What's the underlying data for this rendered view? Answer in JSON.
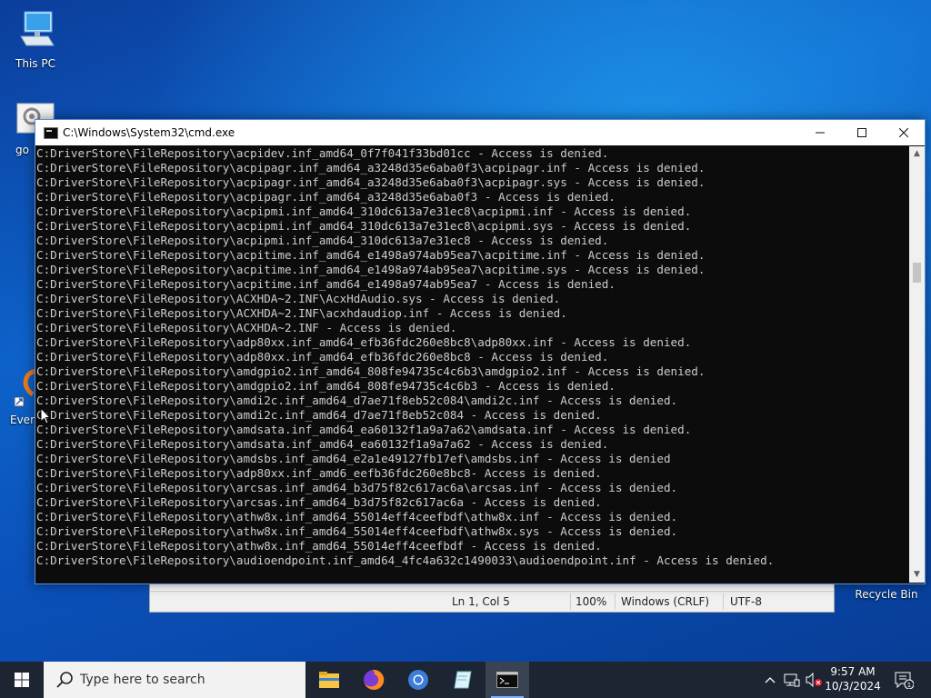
{
  "desktop": {
    "this_pc_label": "This PC",
    "recycle_label": "Recycle Bin",
    "partial_go": "go",
    "partial_every": "Every"
  },
  "cmd": {
    "title": "C:\\Windows\\System32\\cmd.exe",
    "lines": [
      "C:DriverStore\\FileRepository\\acpidev.inf_amd64_0f7f041f33bd01cc - Access is denied.",
      "C:DriverStore\\FileRepository\\acpipagr.inf_amd64_a3248d35e6aba0f3\\acpipagr.inf - Access is denied.",
      "C:DriverStore\\FileRepository\\acpipagr.inf_amd64_a3248d35e6aba0f3\\acpipagr.sys - Access is denied.",
      "C:DriverStore\\FileRepository\\acpipagr.inf_amd64_a3248d35e6aba0f3 - Access is denied.",
      "C:DriverStore\\FileRepository\\acpipmi.inf_amd64_310dc613a7e31ec8\\acpipmi.inf - Access is denied.",
      "C:DriverStore\\FileRepository\\acpipmi.inf_amd64_310dc613a7e31ec8\\acpipmi.sys - Access is denied.",
      "C:DriverStore\\FileRepository\\acpipmi.inf_amd64_310dc613a7e31ec8 - Access is denied.",
      "C:DriverStore\\FileRepository\\acpitime.inf_amd64_e1498a974ab95ea7\\acpitime.inf - Access is denied.",
      "C:DriverStore\\FileRepository\\acpitime.inf_amd64_e1498a974ab95ea7\\acpitime.sys - Access is denied.",
      "C:DriverStore\\FileRepository\\acpitime.inf_amd64_e1498a974ab95ea7 - Access is denied.",
      "C:DriverStore\\FileRepository\\ACXHDA~2.INF\\AcxHdAudio.sys - Access is denied.",
      "C:DriverStore\\FileRepository\\ACXHDA~2.INF\\acxhdaudiop.inf - Access is denied.",
      "C:DriverStore\\FileRepository\\ACXHDA~2.INF - Access is denied.",
      "C:DriverStore\\FileRepository\\adp80xx.inf_amd64_efb36fdc260e8bc8\\adp80xx.inf - Access is denied.",
      "C:DriverStore\\FileRepository\\adp80xx.inf_amd64_efb36fdc260e8bc8 - Access is denied.",
      "C:DriverStore\\FileRepository\\amdgpio2.inf_amd64_808fe94735c4c6b3\\amdgpio2.inf - Access is denied.",
      "C:DriverStore\\FileRepository\\amdgpio2.inf_amd64_808fe94735c4c6b3 - Access is denied.",
      "C:DriverStore\\FileRepository\\amdi2c.inf_amd64_d7ae71f8eb52c084\\amdi2c.inf - Access is denied.",
      "C:DriverStore\\FileRepository\\amdi2c.inf_amd64_d7ae71f8eb52c084 - Access is denied.",
      "C:DriverStore\\FileRepository\\amdsata.inf_amd64_ea60132f1a9a7a62\\amdsata.inf - Access is denied.",
      "C:DriverStore\\FileRepository\\amdsata.inf_amd64_ea60132f1a9a7a62 - Access is denied.",
      "C:DriverStore\\FileRepository\\amdsbs.inf_amd64_e2a1e49127fb17ef\\amdsbs.inf - Access is denied",
      "C:DriverStore\\FileRepository\\adp80xx.inf_amd6_eefb36fdc260e8bc8- Access is denied.",
      "C:DriverStore\\FileRepository\\arcsas.inf_amd64_b3d75f82c617ac6a\\arcsas.inf - Access is denied.",
      "C:DriverStore\\FileRepository\\arcsas.inf_amd64_b3d75f82c617ac6a - Access is denied.",
      "C:DriverStore\\FileRepository\\athw8x.inf_amd64_55014eff4ceefbdf\\athw8x.inf - Access is denied.",
      "C:DriverStore\\FileRepository\\athw8x.inf_amd64_55014eff4ceefbdf\\athw8x.sys - Access is denied.",
      "C:DriverStore\\FileRepository\\athw8x.inf_amd64_55014eff4ceefbdf - Access is denied.",
      "C:DriverStore\\FileRepository\\audioendpoint.inf_amd64_4fc4a632c1490033\\audioendpoint.inf - Access is denied."
    ]
  },
  "notepad": {
    "cursor": "Ln 1, Col 5",
    "zoom": "100%",
    "line_ending": "Windows (CRLF)",
    "encoding": "UTF-8"
  },
  "taskbar": {
    "search_placeholder": "Type here to search",
    "time": "9:57 AM",
    "date": "10/3/2024",
    "notification_count": "1"
  }
}
